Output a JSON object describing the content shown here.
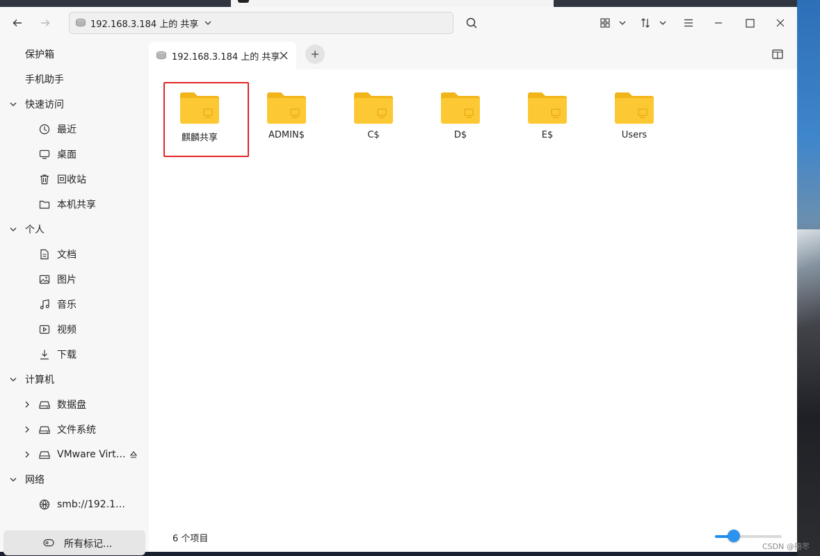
{
  "colors": {
    "accent": "#2b93ef",
    "folder": "#f9c02c",
    "highlight_border": "#e12424"
  },
  "toolbar": {
    "back_icon": "arrow-left-icon",
    "forward_icon": "arrow-right-icon",
    "address": "192.168.3.184 上的 共享",
    "search_icon": "search-icon",
    "view_icon": "grid-view-icon",
    "sort_icon": "sort-icon",
    "menu_icon": "hamburger-menu-icon",
    "minimize_icon": "minimize-icon",
    "maximize_icon": "maximize-icon",
    "close_icon": "close-icon"
  },
  "sidebar": {
    "top_items": [
      {
        "label": "保护箱"
      },
      {
        "label": "手机助手"
      }
    ],
    "quick_access": {
      "label": "快速访问",
      "items": [
        {
          "label": "最近",
          "icon": "clock-icon"
        },
        {
          "label": "桌面",
          "icon": "desktop-icon"
        },
        {
          "label": "回收站",
          "icon": "trash-icon"
        },
        {
          "label": "本机共享",
          "icon": "folder-icon"
        }
      ]
    },
    "personal": {
      "label": "个人",
      "items": [
        {
          "label": "文档",
          "icon": "document-icon"
        },
        {
          "label": "图片",
          "icon": "image-icon"
        },
        {
          "label": "音乐",
          "icon": "music-icon"
        },
        {
          "label": "视频",
          "icon": "video-icon"
        },
        {
          "label": "下载",
          "icon": "download-icon"
        }
      ]
    },
    "computer": {
      "label": "计算机",
      "items": [
        {
          "label": "数据盘",
          "icon": "drive-icon"
        },
        {
          "label": "文件系统",
          "icon": "drive-icon"
        },
        {
          "label": "VMware Virt…",
          "icon": "optical-drive-icon"
        }
      ]
    },
    "network": {
      "label": "网络",
      "items": [
        {
          "label": "smb://192.1…",
          "icon": "network-icon"
        }
      ]
    },
    "tags_button": "所有标记..."
  },
  "tab": {
    "label": "192.168.3.184 上的 共享"
  },
  "files": [
    {
      "name": "麒麟共享"
    },
    {
      "name": "ADMIN$"
    },
    {
      "name": "C$"
    },
    {
      "name": "D$"
    },
    {
      "name": "E$"
    },
    {
      "name": "Users"
    }
  ],
  "status": {
    "count": "6 个项目",
    "zoom_level": 0.28
  },
  "watermark": "CSDN @冊罖"
}
